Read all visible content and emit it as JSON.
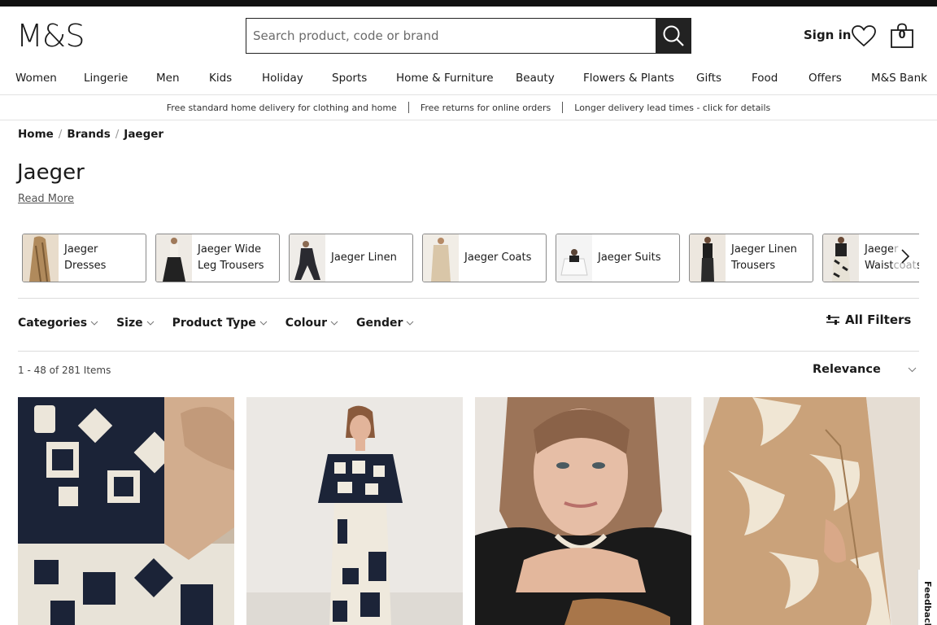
{
  "header": {
    "logo": "M&S",
    "search_placeholder": "Search product, code or brand",
    "sign_in": "Sign in",
    "basket_count": "0"
  },
  "nav": [
    "Women",
    "Lingerie",
    "Men",
    "Kids",
    "Holiday",
    "Sports",
    "Home & Furniture",
    "Beauty",
    "Flowers & Plants",
    "Gifts",
    "Food",
    "Offers",
    "M&S Bank"
  ],
  "promo": [
    "Free standard home delivery for clothing and home",
    "Free returns for online orders",
    "Longer delivery lead times - click for details"
  ],
  "breadcrumb": [
    "Home",
    "Brands",
    "Jaeger"
  ],
  "page": {
    "title": "Jaeger",
    "read_more": "Read More"
  },
  "categories": [
    {
      "line1": "Jaeger",
      "line2": "Dresses"
    },
    {
      "line1": "Jaeger Wide",
      "line2": "Leg Trousers"
    },
    {
      "line1": "Jaeger Linen",
      "line2": ""
    },
    {
      "line1": "Jaeger Coats",
      "line2": ""
    },
    {
      "line1": "Jaeger Suits",
      "line2": ""
    },
    {
      "line1": "Jaeger Linen",
      "line2": "Trousers"
    },
    {
      "line1": "Jaeger",
      "line2": "Waistcoats"
    }
  ],
  "filters": [
    "Categories",
    "Size",
    "Product Type",
    "Colour",
    "Gender"
  ],
  "all_filters": "All Filters",
  "results": {
    "count": "1 - 48 of 281 Items",
    "sort": "Relevance"
  },
  "feedback": "Feedback",
  "colors": {
    "text": "#1a1a1a",
    "border": "#dcdcdc",
    "search_button": "#222222"
  }
}
